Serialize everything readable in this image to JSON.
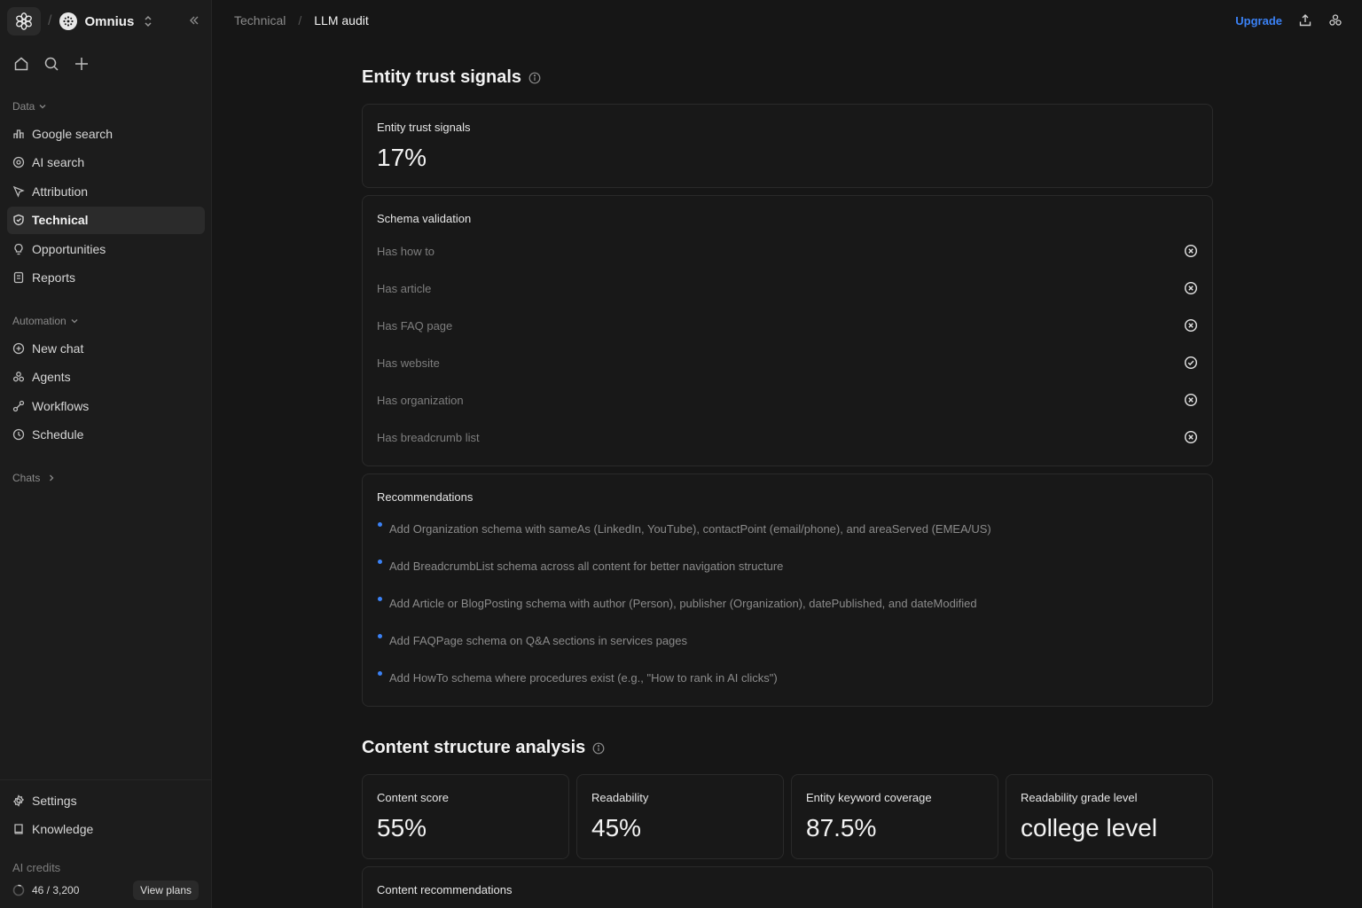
{
  "workspace": {
    "name": "Omnius"
  },
  "sidebar": {
    "data_label": "Data",
    "data_items": [
      {
        "label": "Google search",
        "icon": "bar-chart-icon"
      },
      {
        "label": "AI search",
        "icon": "ai-sparkle-icon"
      },
      {
        "label": "Attribution",
        "icon": "cursor-icon"
      },
      {
        "label": "Technical",
        "icon": "shield-icon",
        "active": true
      },
      {
        "label": "Opportunities",
        "icon": "lightbulb-icon"
      },
      {
        "label": "Reports",
        "icon": "report-icon"
      }
    ],
    "automation_label": "Automation",
    "automation_items": [
      {
        "label": "New chat",
        "icon": "new-chat-icon"
      },
      {
        "label": "Agents",
        "icon": "agents-icon"
      },
      {
        "label": "Workflows",
        "icon": "workflow-icon"
      },
      {
        "label": "Schedule",
        "icon": "clock-icon"
      }
    ],
    "chats_label": "Chats",
    "bottom_items": [
      {
        "label": "Settings",
        "icon": "gear-icon"
      },
      {
        "label": "Knowledge",
        "icon": "book-icon"
      }
    ],
    "credits_label": "AI credits",
    "credits_value": "46 / 3,200",
    "credits_used_fraction": 0.014,
    "view_plans": "View plans"
  },
  "header": {
    "breadcrumb": [
      "Technical",
      "LLM audit"
    ],
    "upgrade": "Upgrade"
  },
  "entity_section": {
    "title": "Entity trust signals",
    "score_card": {
      "label": "Entity trust signals",
      "value": "17%"
    },
    "schema": {
      "title": "Schema validation",
      "rows": [
        {
          "label": "Has how to",
          "status": "fail"
        },
        {
          "label": "Has article",
          "status": "fail"
        },
        {
          "label": "Has FAQ page",
          "status": "fail"
        },
        {
          "label": "Has website",
          "status": "pass"
        },
        {
          "label": "Has organization",
          "status": "fail"
        },
        {
          "label": "Has breadcrumb list",
          "status": "fail"
        }
      ]
    },
    "recommendations": {
      "title": "Recommendations",
      "items": [
        "Add Organization schema with sameAs (LinkedIn, YouTube), contactPoint (email/phone), and areaServed (EMEA/US)",
        "Add BreadcrumbList schema across all content for better navigation structure",
        "Add Article or BlogPosting schema with author (Person), publisher (Organization), datePublished, and dateModified",
        "Add FAQPage schema on Q&A sections in services pages",
        "Add HowTo schema where procedures exist (e.g., \"How to rank in AI clicks\")"
      ]
    }
  },
  "content_section": {
    "title": "Content structure analysis",
    "metrics": [
      {
        "label": "Content score",
        "value": "55%"
      },
      {
        "label": "Readability",
        "value": "45%"
      },
      {
        "label": "Entity keyword coverage",
        "value": "87.5%"
      },
      {
        "label": "Readability grade level",
        "value": "college level"
      }
    ],
    "recommendations_title": "Content recommendations"
  },
  "colors": {
    "accent": "#3b82f6",
    "background": "#161616",
    "sidebar": "#1c1c1c"
  }
}
